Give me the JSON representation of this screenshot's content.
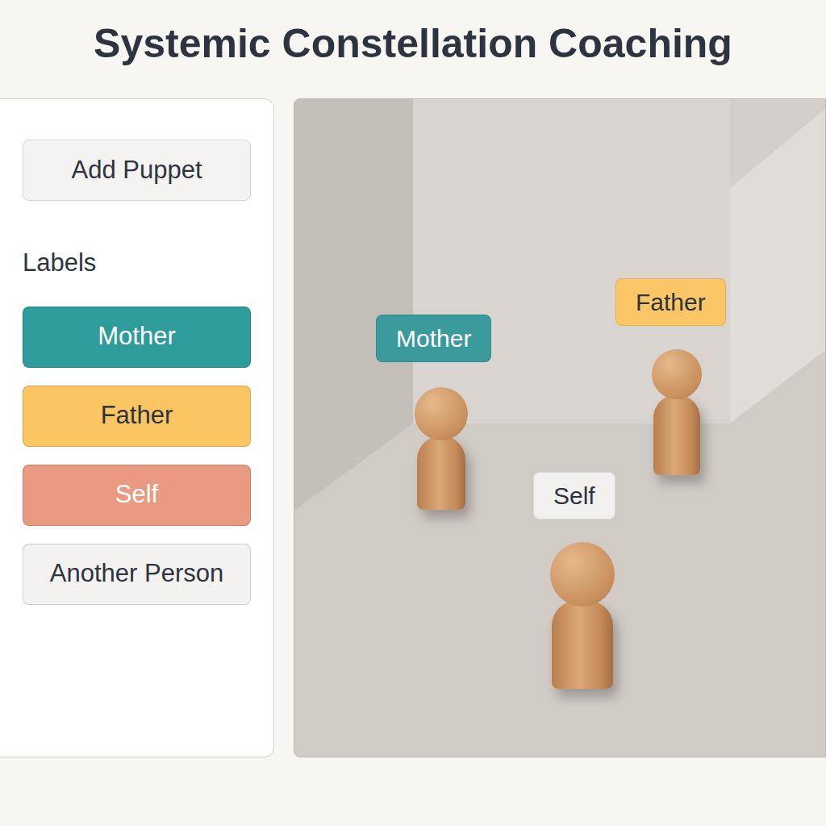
{
  "title": "Systemic Constellation Coaching",
  "sidebar": {
    "add_button": "Add Puppet",
    "labels_heading": "Labels",
    "labels": [
      {
        "name": "Mother",
        "color": "#2f9c9c"
      },
      {
        "name": "Father",
        "color": "#fbc562"
      },
      {
        "name": "Self",
        "color": "#e99a80"
      },
      {
        "name": "Another Person",
        "color": "#f4f2f0"
      }
    ]
  },
  "canvas": {
    "puppets": [
      {
        "label": "Mother",
        "color": "#3a9a9c"
      },
      {
        "label": "Father",
        "color": "#fbc665"
      },
      {
        "label": "Self",
        "color": "#f3f1ef"
      }
    ]
  }
}
